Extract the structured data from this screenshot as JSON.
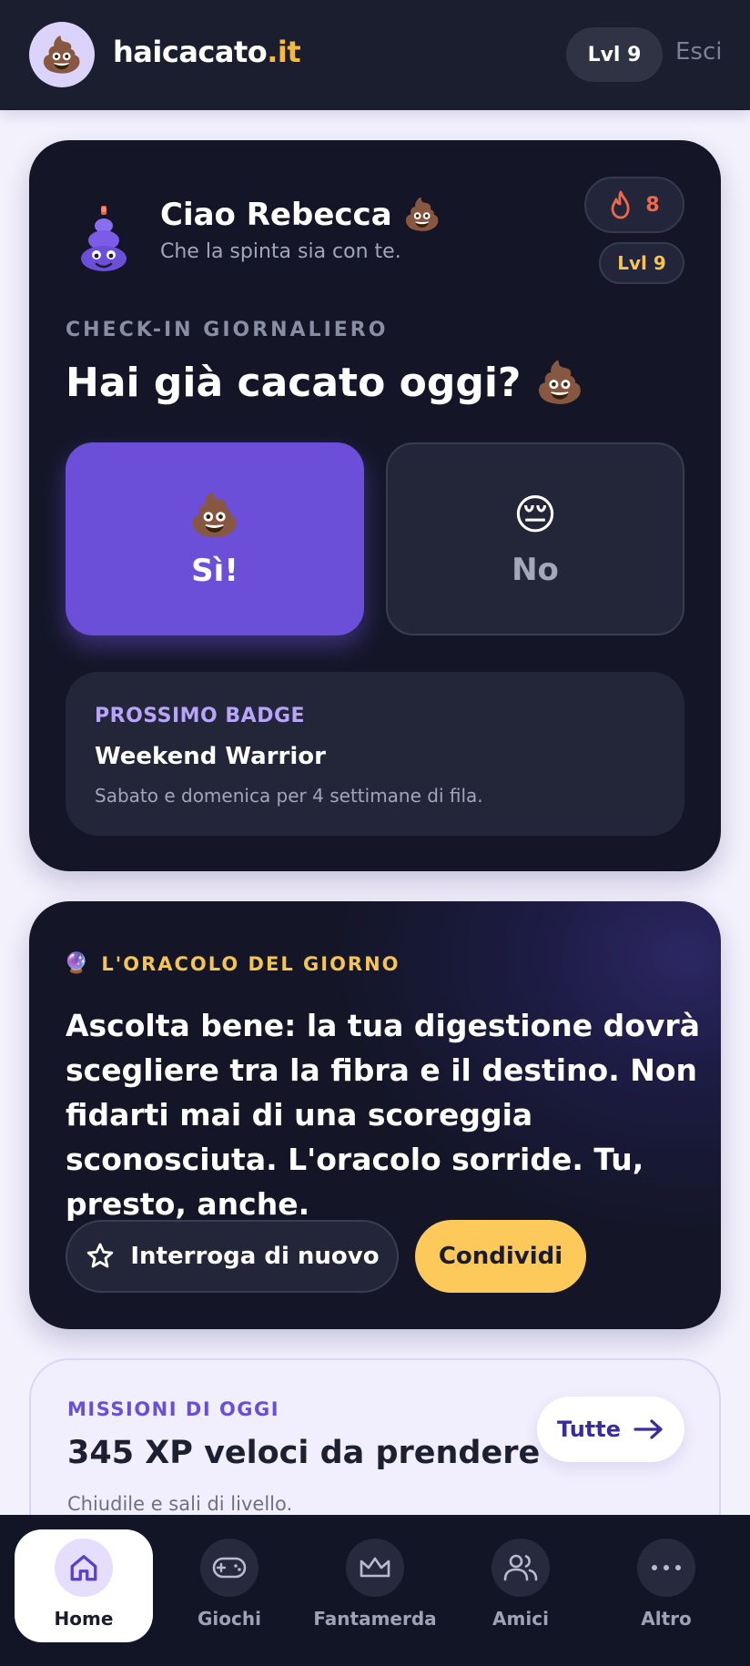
{
  "header": {
    "logo_emoji": "💩",
    "brand_name": "haicacato",
    "brand_tld": ".it",
    "level_badge": "Lvl 9",
    "logout_label": "Esci"
  },
  "welcome": {
    "greeting": "Ciao Rebecca 💩",
    "subtitle": "Che la spinta sia con te.",
    "streak_count": "8",
    "level": "Lvl 9"
  },
  "checkin": {
    "label": "CHECK-IN GIORNALIERO",
    "question": "Hai già cacato oggi? 💩",
    "yes_emoji": "💩",
    "yes_label": "Sì!",
    "no_emoji": "😔",
    "no_label": "No"
  },
  "next_badge": {
    "kicker": "PROSSIMO BADGE",
    "title": "Weekend Warrior",
    "description": "Sabato e domenica per 4 settimane di fila."
  },
  "oracle": {
    "emoji": "🔮",
    "kicker": "L'ORACOLO DEL GIORNO",
    "text": "Ascolta bene: la tua digestione dovrà scegliere tra la fibra e il destino. Non fidarti mai di una scoreggia sconosciuta. L'oracolo sorride. Tu, presto, anche.",
    "ask_again_label": "Interroga di nuovo",
    "share_label": "Condividi"
  },
  "missions": {
    "kicker": "MISSIONI DI OGGI",
    "title": "345 XP veloci da prendere",
    "subtitle": "Chiudile e sali di livello.",
    "all_label": "Tutte"
  },
  "nav": {
    "items": [
      {
        "label": "Home",
        "icon": "home-icon",
        "active": true
      },
      {
        "label": "Giochi",
        "icon": "gamepad-icon",
        "active": false
      },
      {
        "label": "Fantamerda",
        "icon": "crown-icon",
        "active": false
      },
      {
        "label": "Amici",
        "icon": "friends-icon",
        "active": false
      },
      {
        "label": "Altro",
        "icon": "more-icon",
        "active": false
      }
    ]
  },
  "colors": {
    "accent_purple": "#6c4fd9",
    "accent_yellow": "#fdc95b",
    "card_dark": "#141628",
    "page_bg": "#f3f1fc",
    "streak_orange": "#f0684c"
  }
}
